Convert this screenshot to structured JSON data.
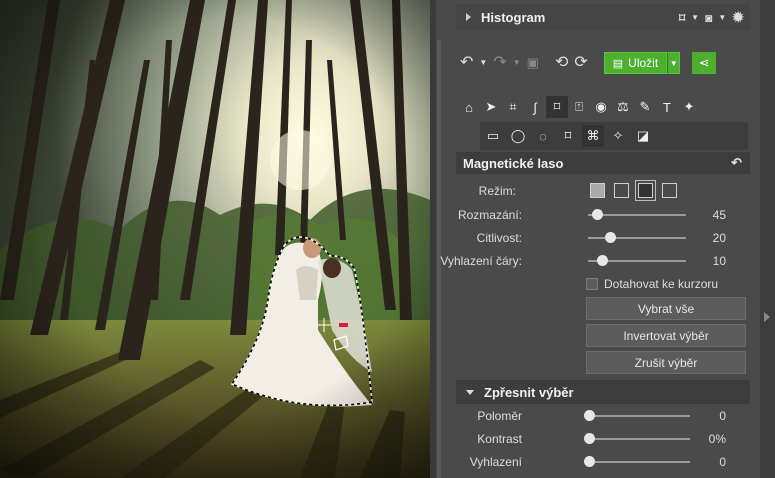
{
  "histogram": {
    "title": "Histogram"
  },
  "toolbar": {
    "save_label": "Uložit"
  },
  "lasso": {
    "title": "Magnetické laso",
    "mode_label": "Režim:",
    "sliders": [
      {
        "label": "Rozmazání:",
        "value": "45",
        "level": 0.03
      },
      {
        "label": "Citlivost:",
        "value": "20",
        "level": 0.14
      },
      {
        "label": "Vyhlazení čáry:",
        "value": "10",
        "level": 0.05
      }
    ],
    "cursor_label": "Dotahovat ke kurzoru",
    "buttons": {
      "select_all": "Vybrat vše",
      "invert": "Invertovat výběr",
      "clear": "Zrušit výběr"
    }
  },
  "refine": {
    "title": "Zpřesnit výběr",
    "sliders": [
      {
        "label": "Poloměr",
        "value": "0",
        "level": 0
      },
      {
        "label": "Kontrast",
        "value": "0%",
        "level": 0
      },
      {
        "label": "Vyhlazení",
        "value": "0",
        "level": 0
      }
    ]
  },
  "colors": {
    "accent": "#4caf2e",
    "panel": "#4a4a4a",
    "header": "#3d3d3d"
  }
}
